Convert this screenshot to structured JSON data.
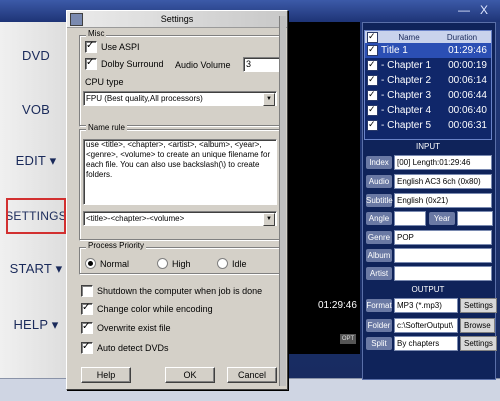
{
  "window": {
    "close_glyph": "X",
    "minimize_glyph": "—"
  },
  "nav": {
    "items": [
      {
        "label": "DVD"
      },
      {
        "label": "VOB"
      },
      {
        "label": "EDIT ▾"
      },
      {
        "label": "SETTINGS"
      },
      {
        "label": "START ▾"
      },
      {
        "label": "HELP ▾"
      }
    ]
  },
  "player": {
    "time": "01:29:46",
    "opt_label": "OPT"
  },
  "titles": {
    "headers": {
      "name": "Name",
      "duration": "Duration"
    },
    "rows": [
      {
        "name": "Title 1",
        "duration": "01:29:46"
      },
      {
        "name": "- Chapter 1",
        "duration": "00:00:19"
      },
      {
        "name": "- Chapter 2",
        "duration": "00:06:14"
      },
      {
        "name": "- Chapter 3",
        "duration": "00:06:44"
      },
      {
        "name": "- Chapter 4",
        "duration": "00:06:40"
      },
      {
        "name": "- Chapter 5",
        "duration": "00:06:31"
      }
    ]
  },
  "input": {
    "title": "INPUT",
    "index_label": "Index",
    "index_value": "[00] Length:01:29:46",
    "audio_label": "Audio",
    "audio_value": "English AC3 6ch (0x80)",
    "subtitle_label": "Subtitle",
    "subtitle_value": "English (0x21)",
    "angle_label": "Angle",
    "year_label": "Year",
    "genre_label": "Genre",
    "genre_value": "POP",
    "album_label": "Album",
    "artist_label": "Artist"
  },
  "output": {
    "title": "OUTPUT",
    "format_label": "Format",
    "format_value": "MP3 (*.mp3)",
    "settings_label": "Settings",
    "folder_label": "Folder",
    "folder_value": "c:\\SofterOutput\\",
    "browse_label": "Browse",
    "split_label": "Split",
    "split_value": "By chapters",
    "split_settings_label": "Settings"
  },
  "dialog": {
    "title": "Settings",
    "misc_label": "Misc",
    "use_aspi": "Use ASPI",
    "dolby_surround": "Dolby Surround",
    "audio_volume_label": "Audio Volume",
    "audio_volume_value": "3",
    "cpu_type_label": "CPU type",
    "cpu_type_value": "FPU (Best quality,All processors)",
    "name_rule_label": "Name rule",
    "name_rule_help": "use <title>, <chapter>, <artist>, <album>, <year>, <genre>, <volume> to create an unique filename for each file. You can also use backslash(\\) to create folders.",
    "name_rule_value": "<title>-<chapter>-<volume>",
    "process_priority_label": "Process Priority",
    "priority_normal": "Normal",
    "priority_high": "High",
    "priority_idle": "Idle",
    "shutdown_label": "Shutdown the computer when job is done",
    "change_color_label": "Change color while encoding",
    "overwrite_label": "Overwrite exist file",
    "auto_detect_label": "Auto detect DVDs",
    "help_button": "Help",
    "ok_button": "OK",
    "cancel_button": "Cancel"
  }
}
